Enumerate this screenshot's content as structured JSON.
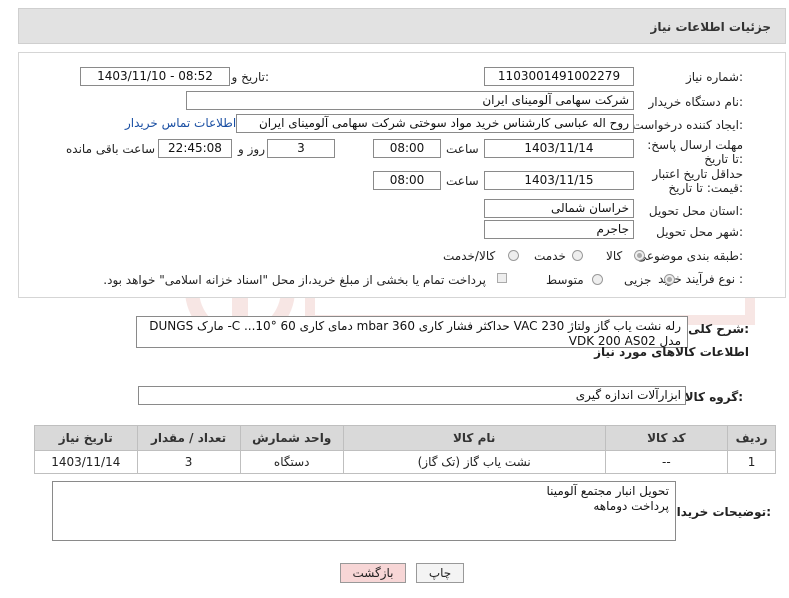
{
  "header": {
    "title": "جزئیات اطلاعات نیاز"
  },
  "form": {
    "need_number_label": "شماره نیاز:",
    "need_number": "1103001491002279",
    "announce_label": "تاریخ و ساعت اعلان عمومی:",
    "announce_value": "1403/11/10 - 08:52",
    "buyer_label": "نام دستگاه خریدار:",
    "buyer": "شرکت سهامی آلومینای ایران",
    "creator_label": "ایجاد کننده درخواست:",
    "creator": "روح اله عباسی کارشناس خرید مواد سوختی شرکت سهامی آلومینای ایران",
    "contact_link": "اطلاعات تماس خریدار",
    "deadline_label": "مهلت ارسال پاسخ: تا تاریخ:",
    "deadline_date": "1403/11/14",
    "time_label": "ساعت",
    "deadline_time": "08:00",
    "days_value": "3",
    "days_label": "روز و",
    "remaining_time": "22:45:08",
    "remaining_label": "ساعت باقی مانده",
    "validity_label": "حداقل تاریخ اعتبار قیمت: تا تاریخ:",
    "validity_date": "1403/11/15",
    "validity_time": "08:00",
    "province_label": "استان محل تحویل:",
    "province": "خراسان شمالی",
    "city_label": "شهر محل تحویل:",
    "city": "جاجرم",
    "category_label": "طبقه بندی موضوعی:",
    "category_options": [
      "کالا",
      "خدمت",
      "کالا/خدمت"
    ],
    "process_label": "نوع فرآیند خرید :",
    "process_options": [
      "جزیی",
      "متوسط"
    ],
    "payment_note": "پرداخت تمام یا بخشی از مبلغ خرید،از محل \"اسناد خزانه اسلامی\" خواهد بود."
  },
  "description": {
    "label": "شرح کلی نیاز:",
    "text": "رله نشت یاب گاز ولتاژ 230 VAC حداکثر فشار کاری 360 mbar دمای کاری 60 °C ...10- مارک DUNGS مدل VDK 200 AS02"
  },
  "items_section": {
    "title": "اطلاعات کالاهای مورد نیاز",
    "group_label": "گروه کالا:",
    "group_value": "ابزارآلات اندازه گیری",
    "columns": [
      "ردیف",
      "کد کالا",
      "نام کالا",
      "واحد شمارش",
      "تعداد / مقدار",
      "تاریخ نیاز"
    ],
    "rows": [
      {
        "row": "1",
        "code": "--",
        "name": "نشت یاب گاز (تک گاز)",
        "unit": "دستگاه",
        "qty": "3",
        "date": "1403/11/14"
      }
    ]
  },
  "buyer_notes": {
    "label": "توضیحات خریدار:",
    "line1": "تحویل انبار مجتمع آلومینا",
    "line2": "پرداخت دوماهه"
  },
  "buttons": {
    "print": "چاپ",
    "back": "بازگشت"
  },
  "colors": {
    "header_bg": "#e2e2e2",
    "link": "#1a4fa3",
    "back_btn_bg": "#f7d6d6",
    "watermark": "#c0392b"
  }
}
